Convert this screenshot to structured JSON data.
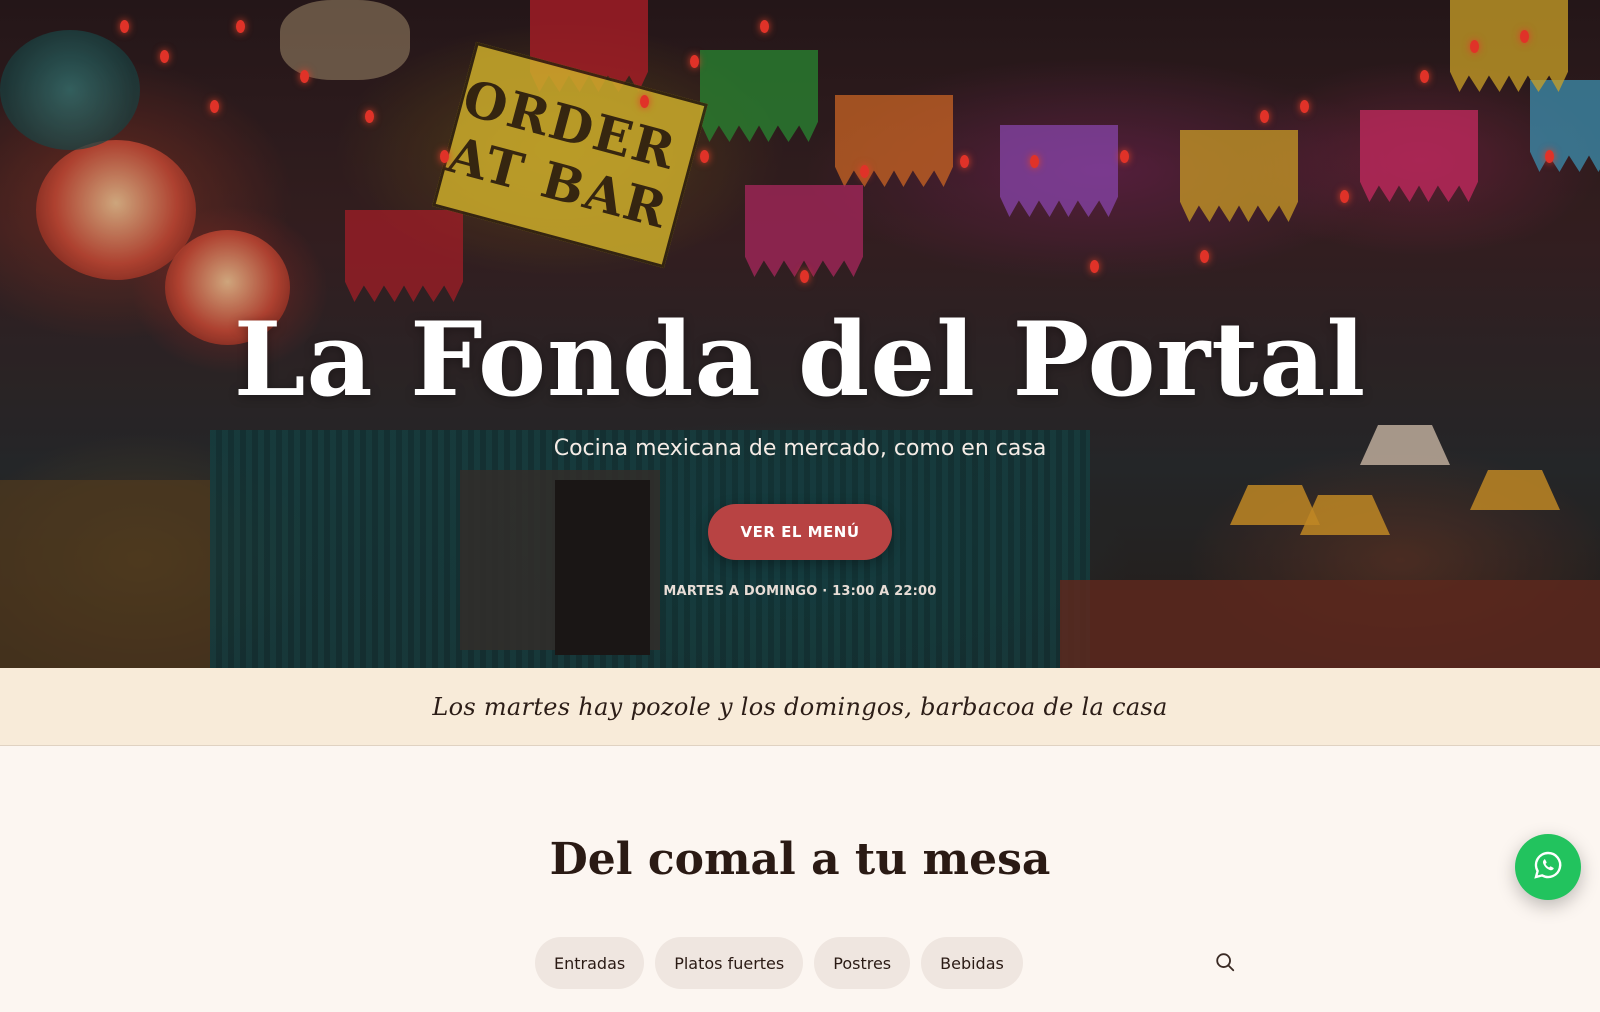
{
  "hero": {
    "title": "La Fonda del Portal",
    "subtitle": "Cocina mexicana de mercado, como en casa",
    "cta_label": "VER EL MENÚ",
    "hours": "MARTES A DOMINGO · 13:00 A 22:00",
    "sign_text": "ORDER AT BAR"
  },
  "banner": {
    "text": "Los martes hay pozole y los domingos, barbacoa de la casa"
  },
  "menu": {
    "title": "Del comal a tu mesa",
    "tabs": [
      {
        "label": "Entradas"
      },
      {
        "label": "Platos fuertes"
      },
      {
        "label": "Postres"
      },
      {
        "label": "Bebidas"
      }
    ],
    "search_icon": "search-icon"
  },
  "whatsapp": {
    "icon": "whatsapp-icon",
    "color": "#22c35e"
  },
  "colors": {
    "accent": "#b84343",
    "banner_bg": "#f8ebd9",
    "page_bg": "#fcf6f1",
    "text_dark": "#2a1a14"
  }
}
